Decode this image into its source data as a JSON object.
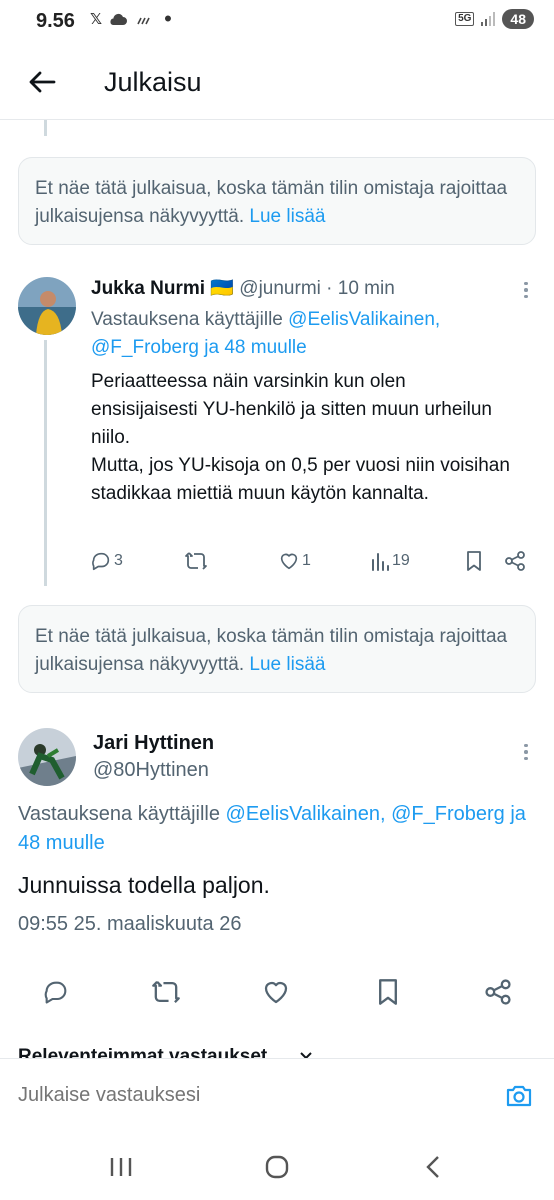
{
  "status_bar": {
    "time": "9.56",
    "network": "5G",
    "battery": "48"
  },
  "header": {
    "title": "Julkaisu"
  },
  "notice_1": {
    "text": "Et näe tätä julkaisua, koska tämän tilin omistaja rajoittaa julkaisujensa näkyvyyttä.",
    "link": "Lue lisää"
  },
  "tweet_1": {
    "name": "Jukka Nurmi",
    "flag": "🇺🇦",
    "handle": "@junurmi",
    "separator": "·",
    "age": "10 min",
    "reply_prefix": "Vastauksena käyttäjille",
    "reply_user_1": "@EelisValikainen,",
    "reply_user_2": "@F_Froberg ja 48 muulle",
    "body": "Periaatteessa näin varsinkin kun olen ensisijaisesti YU-henkilö ja sitten muun urheilun niilo.\nMutta, jos YU-kisoja on 0,5 per vuosi niin voisihan stadikkaa miettiä muun käytön kannalta.",
    "replies": "3",
    "reposts": "",
    "likes": "1",
    "views": "19"
  },
  "notice_2": {
    "text": "Et näe tätä julkaisua, koska tämän tilin omistaja rajoittaa julkaisujensa näkyvyyttä.",
    "link": "Lue lisää"
  },
  "tweet_2": {
    "name": "Jari Hyttinen",
    "handle": "@80Hyttinen",
    "reply_prefix": "Vastauksena käyttäjille",
    "reply_users": "@EelisValikainen, @F_Froberg ja",
    "reply_suffix": "48 muulle",
    "body": "Junnuissa todella paljon.",
    "timestamp": "09:55 25. maaliskuuta 26"
  },
  "sort_label": "Releventeimmat vastaukset",
  "reply_bar": {
    "placeholder": "Julkaise vastauksesi"
  },
  "colors": {
    "accent": "#1d9bf0",
    "text": "#0f1419",
    "muted": "#536471"
  }
}
